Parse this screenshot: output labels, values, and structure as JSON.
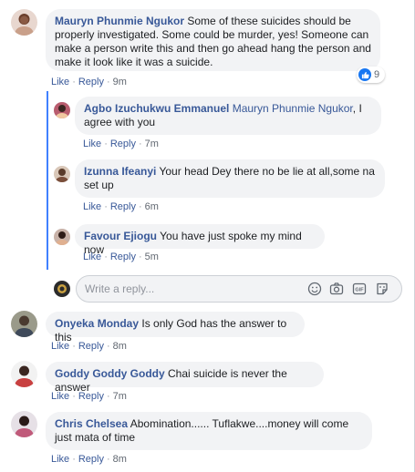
{
  "colors": {
    "link": "#385898",
    "accent": "#4080ff",
    "bubble": "#f2f3f5",
    "reaction": "#1877f2"
  },
  "comments": [
    {
      "author": "Mauryn Phunmie Ngukor",
      "text": "Some of these suicides should be properly investigated. Some could be murder, yes! Someone can make a person write this and then go ahead hang the person and make it look like it was a suicide.",
      "like": "Like",
      "reply": "Reply",
      "time": "9m",
      "reactions": {
        "icon": "thumbs-up-icon",
        "count": "9"
      }
    },
    {
      "author": "Onyeka Monday",
      "text": "Is only God has the answer to this",
      "like": "Like",
      "reply": "Reply",
      "time": "8m"
    },
    {
      "author": "Goddy Goddy Goddy",
      "text": "Chai suicide is never the answer",
      "like": "Like",
      "reply": "Reply",
      "time": "7m"
    },
    {
      "author": "Chris Chelsea",
      "text": "Abomination...... Tuflakwe....money will come just mata of time",
      "like": "Like",
      "reply": "Reply",
      "time": "8m"
    }
  ],
  "replies": [
    {
      "author": "Agbo Izuchukwu Emmanuel",
      "mention": "Mauryn Phunmie Ngukor",
      "text": ", I agree with you",
      "like": "Like",
      "reply": "Reply",
      "time": "7m"
    },
    {
      "author": "Izunna Ifeanyi",
      "text": "Your head Dey there no be lie at all,some na set up",
      "like": "Like",
      "reply": "Reply",
      "time": "6m"
    },
    {
      "author": "Favour Ejiogu",
      "text": "You have just spoke my mind now",
      "like": "Like",
      "reply": "Reply",
      "time": "5m"
    }
  ],
  "reply_box": {
    "placeholder": "Write a reply...",
    "icons": [
      "emoji-icon",
      "camera-icon",
      "gif-icon",
      "sticker-icon"
    ]
  }
}
